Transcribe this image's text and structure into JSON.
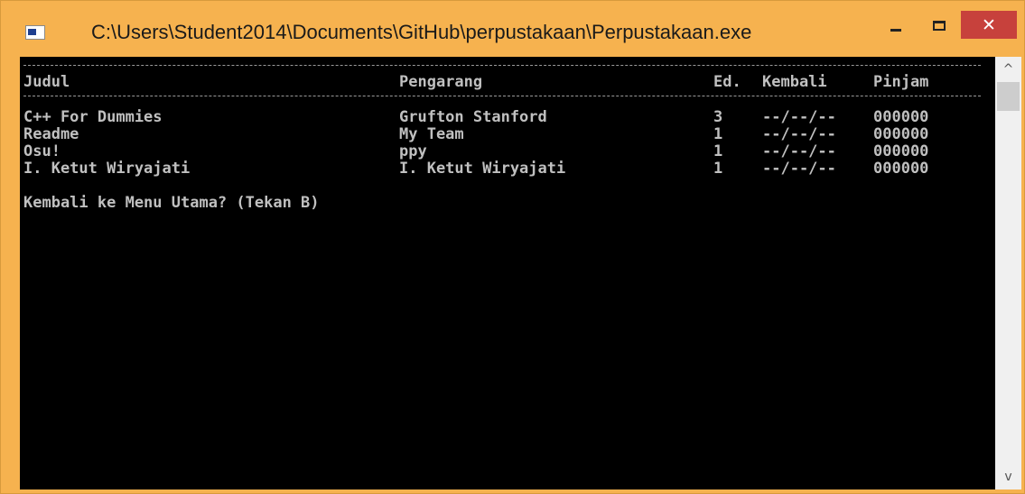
{
  "window": {
    "title": "C:\\Users\\Student2014\\Documents\\GitHub\\perpustakaan\\Perpustakaan.exe",
    "close_glyph": "✕"
  },
  "table": {
    "headers": {
      "judul": "Judul",
      "pengarang": "Pengarang",
      "ed": "Ed.",
      "kembali": "Kembali",
      "pinjam": "Pinjam"
    },
    "rows": [
      {
        "judul": "C++ For Dummies",
        "pengarang": "Grufton Stanford",
        "ed": "3",
        "kembali": "--/--/--",
        "pinjam": "000000"
      },
      {
        "judul": "Readme",
        "pengarang": "My Team",
        "ed": "1",
        "kembali": "--/--/--",
        "pinjam": "000000"
      },
      {
        "judul": "Osu!",
        "pengarang": "ppy",
        "ed": "1",
        "kembali": "--/--/--",
        "pinjam": "000000"
      },
      {
        "judul": "I. Ketut Wiryajati",
        "pengarang": "I. Ketut Wiryajati",
        "ed": "1",
        "kembali": "--/--/--",
        "pinjam": "000000"
      }
    ]
  },
  "prompt": "Kembali ke Menu Utama? (Tekan B)",
  "scrollbar": {
    "up_glyph": "^",
    "down_glyph": "v"
  }
}
